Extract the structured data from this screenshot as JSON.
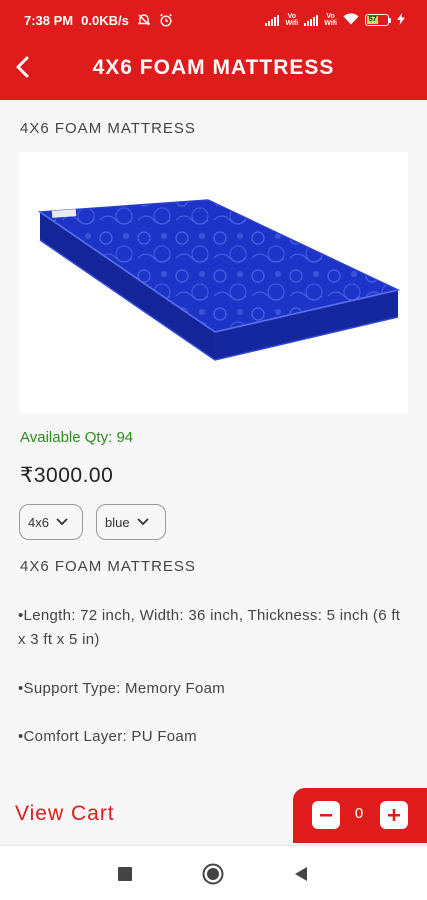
{
  "status_bar": {
    "time": "7:38 PM",
    "speed": "0.0KB/s",
    "battery": "57",
    "network_label": "Vo\nWifi"
  },
  "header": {
    "title": "4X6 FOAM MATTRESS"
  },
  "product": {
    "name": "4X6 FOAM MATTRESS",
    "available_qty": "Available Qty: 94",
    "price": "₹3000.00",
    "size_option": "4x6",
    "color_option": "blue",
    "description_title": "4X6 FOAM MATTRESS",
    "bullets": [
      "•Length: 72 inch, Width: 36 inch, Thickness: 5 inch (6 ft x 3 ft x 5 in)",
      "•Support Type: Memory Foam",
      "•Comfort Layer: PU Foam"
    ]
  },
  "cart": {
    "view_cart_label": "View Cart",
    "quantity": "0"
  },
  "colors": {
    "brand_red": "#e01b1b",
    "available_green": "#2e8b1f",
    "mattress_blue": "#1e34c8"
  }
}
